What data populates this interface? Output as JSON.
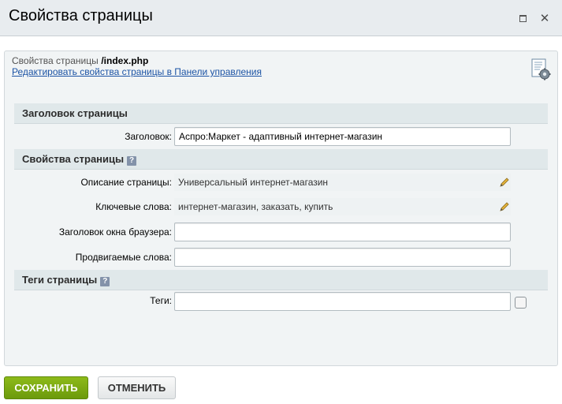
{
  "window": {
    "title": "Свойства страницы"
  },
  "header": {
    "props_label": "Свойства страницы",
    "path": "/index.php",
    "edit_link": "Редактировать свойства страницы в Панели управления"
  },
  "sections": {
    "page_title": "Заголовок страницы",
    "page_props": "Свойства страницы",
    "page_tags": "Теги страницы"
  },
  "fields": {
    "title_label": "Заголовок:",
    "title_value": "Аспро:Маркет - адаптивный интернет-магазин",
    "description_label": "Описание страницы:",
    "description_value": "Универсальный интернет-магазин",
    "keywords_label": "Ключевые слова:",
    "keywords_value": "интернет-магазин, заказать, купить",
    "browser_title_label": "Заголовок окна браузера:",
    "browser_title_value": "",
    "promoted_label": "Продвигаемые слова:",
    "promoted_value": "",
    "tags_label": "Теги:",
    "tags_value": ""
  },
  "buttons": {
    "save": "СОХРАНИТЬ",
    "cancel": "ОТМЕНИТЬ"
  },
  "help_glyph": "?"
}
